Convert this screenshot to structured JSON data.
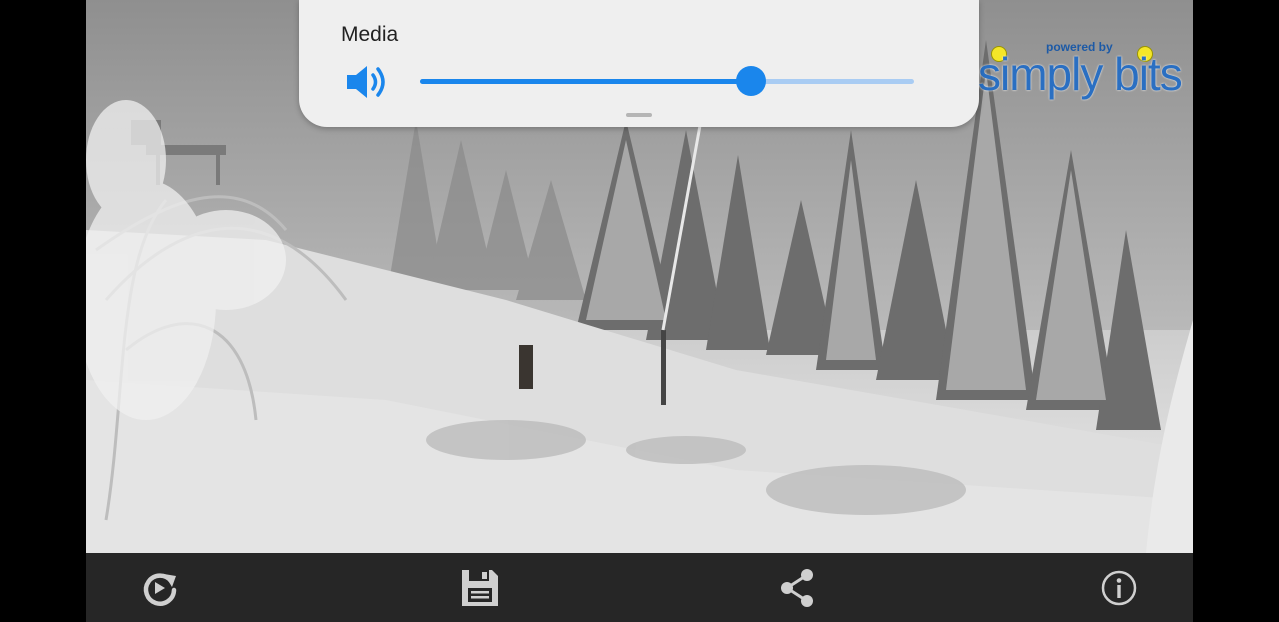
{
  "volume_panel": {
    "label": "Media",
    "volume_level_percent": 67,
    "accent_color": "#1a86ec",
    "track_color": "#a9ccf3"
  },
  "watermark": {
    "powered_text": "powered by",
    "brand_text": "simply bits"
  },
  "toolbar": {
    "buttons": [
      {
        "name": "refresh",
        "icon": "refresh-icon"
      },
      {
        "name": "save",
        "icon": "floppy-disk-icon"
      },
      {
        "name": "share",
        "icon": "share-icon"
      },
      {
        "name": "info",
        "icon": "info-icon"
      }
    ],
    "icon_color": "#cfcfcf",
    "background": "#262626"
  }
}
